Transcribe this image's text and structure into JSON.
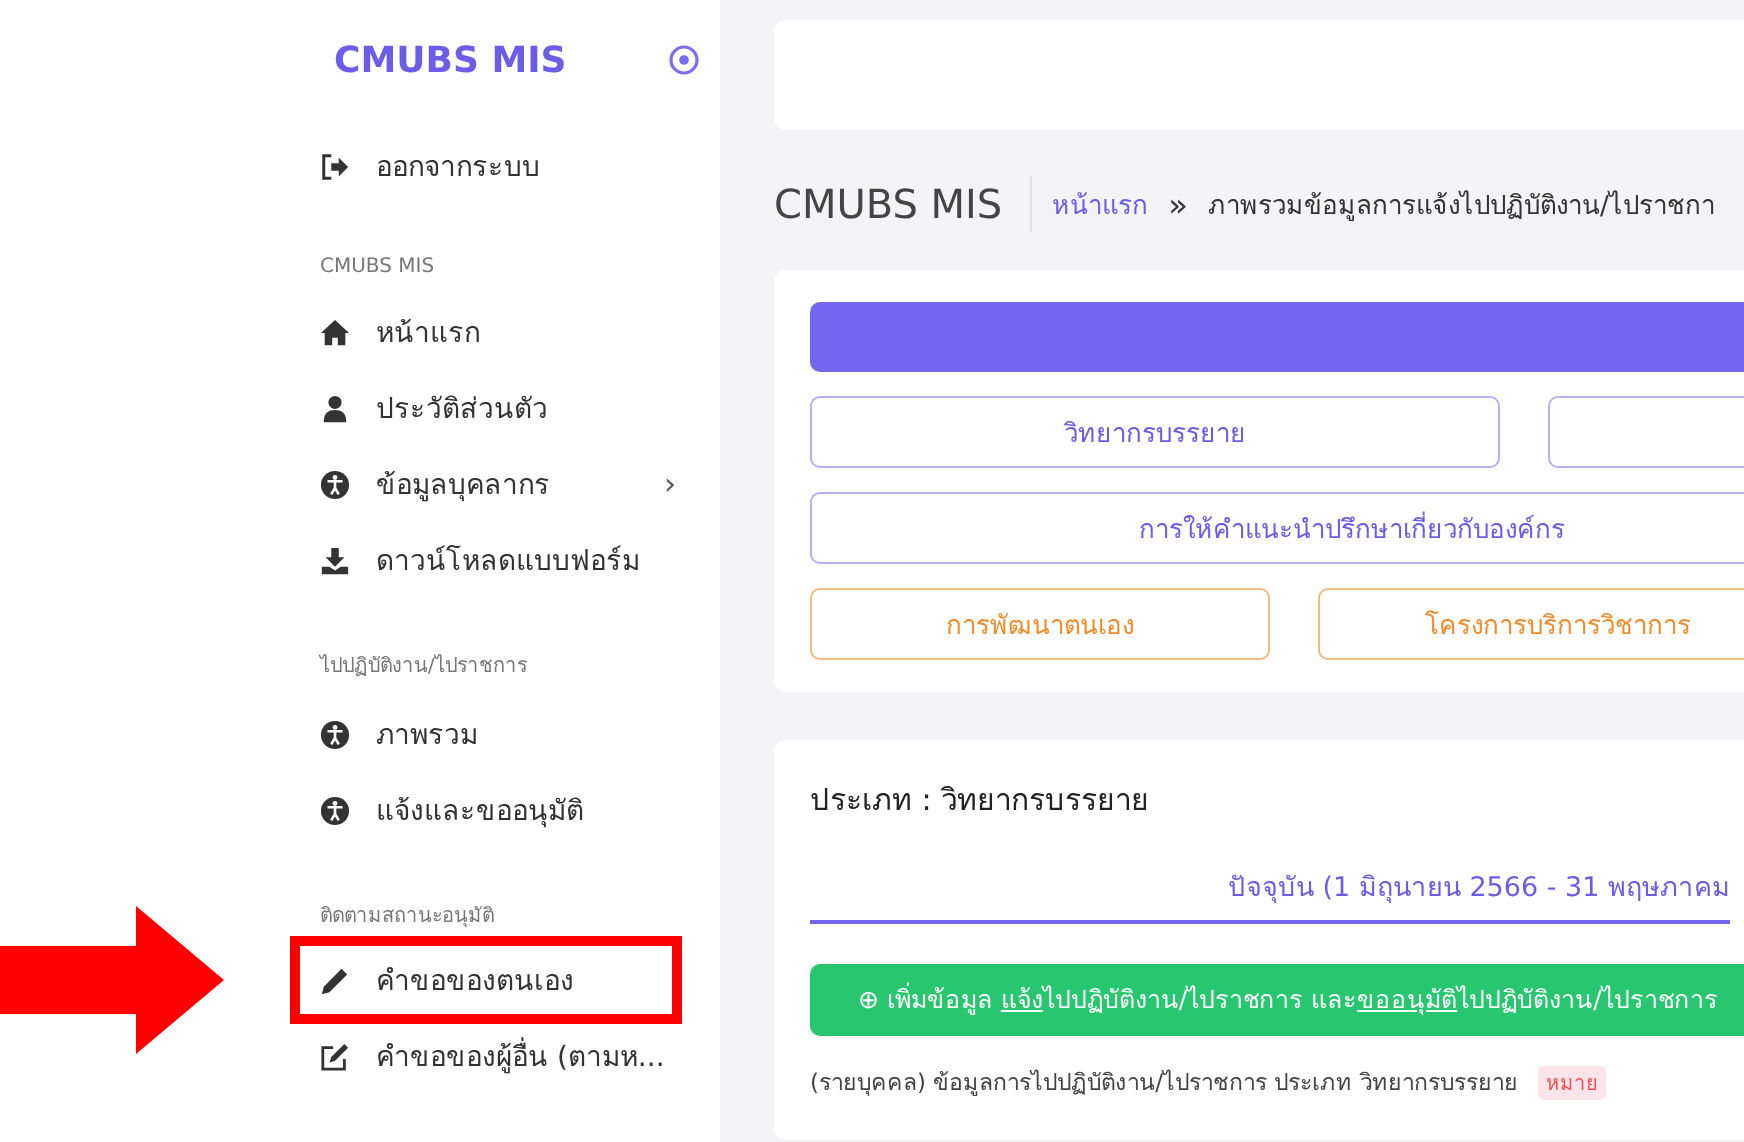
{
  "sidebar": {
    "brand": "CMUBS MIS",
    "logout": "ออกจากระบบ",
    "sections": [
      {
        "title": "CMUBS MIS",
        "items": [
          {
            "label": "หน้าแรก",
            "kind": "home",
            "highlighted": false
          },
          {
            "label": "ประวัติส่วนตัว",
            "kind": "user",
            "highlighted": false
          },
          {
            "label": "ข้อมูลบุคลากร",
            "kind": "person",
            "chevron": "›",
            "highlighted": false
          },
          {
            "label": "ดาวน์โหลดแบบฟอร์ม",
            "kind": "download",
            "highlighted": false
          }
        ]
      },
      {
        "title": "ไปปฏิบัติงาน/ไปราชการ",
        "items": [
          {
            "label": "ภาพรวม",
            "kind": "person",
            "highlighted": false
          },
          {
            "label": "แจ้งและขออนุมัติ",
            "kind": "person",
            "highlighted": false
          }
        ]
      },
      {
        "title": "ติดตามสถานะอนุมัติ",
        "items": [
          {
            "label": "คำขอของตนเอง",
            "kind": "pencil",
            "highlighted": true
          },
          {
            "label": "คำขอของผู้อื่น (ตามห...",
            "kind": "edit",
            "highlighted": false
          }
        ]
      }
    ]
  },
  "page_title": "CMUBS MIS",
  "breadcrumb": [
    {
      "label": "หน้าแรก",
      "link": true
    },
    {
      "separator": "»",
      "label": "ภาพรวมข้อมูลการแจ้งไปปฏิบัติงาน/ไปราชกา",
      "link": false
    }
  ],
  "category_buttons": [
    [
      {
        "label": "วิทยากรบรรยาย",
        "kind": "primary"
      },
      {
        "kind": "primary"
      }
    ],
    [
      {
        "label": "การให้คำแนะนำปรึกษาเกี่ยวกับองค์กร",
        "kind": "primary"
      }
    ],
    [
      {
        "label": "การพัฒนาตนเอง",
        "kind": "warning"
      },
      {
        "label": "โครงการบริการวิชาการ",
        "kind": "warning"
      }
    ]
  ],
  "detail": {
    "type_label": "ประเภท : วิทยากรบรรยาย",
    "tabs": [
      {
        "label": "ปัจจุบัน (1 มิถุนายน 2566 - 31 พฤษภาคม",
        "selected": true
      }
    ],
    "add_button": "⊕ เพิ่มข้อมูล **แจ้ง**ไปปฏิบัติงาน/ไปราชการ และ**ขออนุมัติ**ไปปฏิบัติงาน/ไปราชการ",
    "list_title": "(รายบุคคล) ข้อมูลการไปปฏิบัติงาน/ไปราชการ ประเภท วิทยากรบรรยาย",
    "badge": "หมาย"
  }
}
